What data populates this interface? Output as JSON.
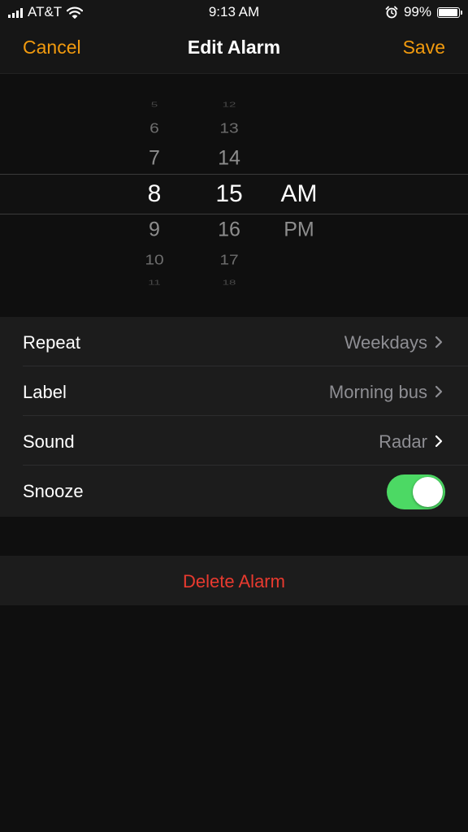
{
  "status_bar": {
    "carrier": "AT&T",
    "time": "9:13 AM",
    "battery_percent": "99%",
    "icons": [
      "signal-icon",
      "wifi-icon",
      "alarm-clock-icon",
      "battery-icon"
    ]
  },
  "nav": {
    "cancel_label": "Cancel",
    "title": "Edit Alarm",
    "save_label": "Save"
  },
  "time_picker": {
    "hours": [
      "5",
      "6",
      "7",
      "8",
      "9",
      "10",
      "11"
    ],
    "minutes": [
      "12",
      "13",
      "14",
      "15",
      "16",
      "17",
      "18"
    ],
    "periods": [
      "AM",
      "PM"
    ],
    "selected": {
      "hour": "8",
      "minute": "15",
      "period": "AM"
    }
  },
  "settings": {
    "repeat": {
      "label": "Repeat",
      "value": "Weekdays"
    },
    "label": {
      "label": "Label",
      "value": "Morning bus"
    },
    "sound": {
      "label": "Sound",
      "value": "Radar"
    },
    "snooze": {
      "label": "Snooze",
      "enabled": true
    }
  },
  "delete_label": "Delete Alarm",
  "colors": {
    "accent": "#f19a0e",
    "toggle_on": "#4cd964",
    "destructive": "#e93a2f",
    "background": "#0f0f0f",
    "group_background": "#1c1c1c",
    "secondary_text": "#8e8e93"
  }
}
